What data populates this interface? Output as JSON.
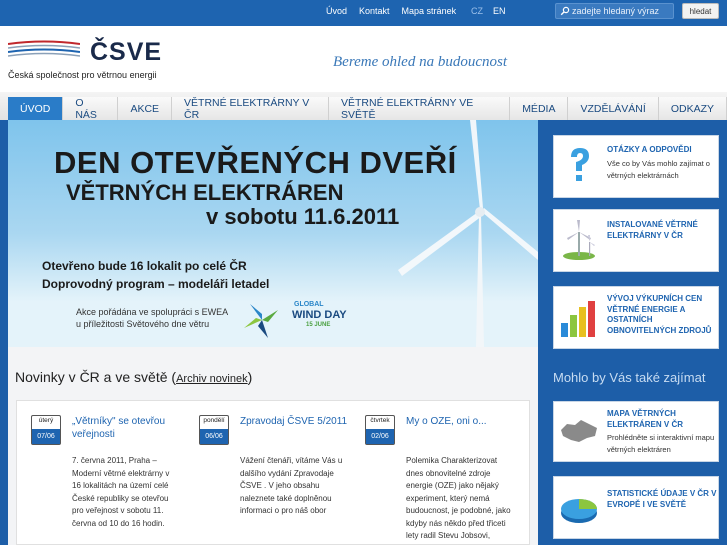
{
  "topbar": {
    "links": [
      "Úvod",
      "Kontakt",
      "Mapa stránek"
    ],
    "lang_cz": "CZ",
    "lang_en": "EN",
    "search_placeholder": "zadejte hledaný výraz",
    "search_button": "hledat"
  },
  "header": {
    "logo_title": "ČSVE",
    "logo_subtitle": "Česká společnost pro větrnou energii",
    "slogan": "Bereme ohled na budoucnost"
  },
  "nav": {
    "items": [
      "Úvod",
      "O nás",
      "Akce",
      "Větrné elektrárny v ČR",
      "Větrné elektrárny ve světě",
      "Média",
      "Vzdělávání",
      "Odkazy"
    ],
    "active_index": 0
  },
  "banner": {
    "line1": "DEN OTEVŘENÝCH DVEŘÍ",
    "line2": "VĚTRNÝCH ELEKTRÁREN",
    "line3": "v sobotu 11.6.2011",
    "line4": "Otevřeno bude 16 lokalit po celé ČR",
    "line5": "Doprovodný program – modeláři letadel",
    "line6": "Akce pořádána ve spolupráci s EWEA",
    "line7": "u příležitosti Světového dne větru",
    "wd_global": "GLOBAL",
    "wd_wind_day": "WIND DAY",
    "wd_date": "15 JUNE"
  },
  "news": {
    "title": "Novinky v ČR a ve světě",
    "archive_open": "(",
    "archive_link": "Archiv novinek",
    "archive_close": ")",
    "items": [
      {
        "day": "úterý",
        "date": "07/06",
        "headline": "„Větrníky\" se otevřou veřejnosti",
        "text": "7. června 2011, Praha – Moderní větrné elektrárny v 16 lokalitách na území celé České republiky se otevřou pro veřejnost v sobotu 11. června od 10 do 16 hodin."
      },
      {
        "day": "pondělí",
        "date": "06/06",
        "headline": "Zpravodaj ČSVE 5/2011",
        "text": "Vážení čtenáři, vítáme Vás u dalšího vydání Zpravodaje ČSVE . V jeho obsahu naleznete také doplněnou informaci o pro náš obor"
      },
      {
        "day": "čtvrtek",
        "date": "02/06",
        "headline": "My o OZE, oni o...",
        "text": "Polemika Charakterizovat dnes obnovitelné zdroje energie (OZE) jako nějaký experiment, který nemá budoucnost, je podobné, jako kdyby nás někdo před třiceti lety radil Stevu Jobsovi,"
      }
    ]
  },
  "sidebar": {
    "cards": [
      {
        "title": "Otázky a odpovědi",
        "desc": "Vše co by Vás mohlo zajímat o větrných elektrárnách",
        "icon": "question-icon"
      },
      {
        "title": "Instalované větrné elektrárny v ČR",
        "desc": "",
        "icon": "wind-turbine-icon"
      },
      {
        "title": "Vývoj výkupních cen větrné energie a ostatních obnovitelných zdrojů",
        "desc": "",
        "icon": "bar-chart-icon"
      }
    ],
    "also_title": "Mohlo by Vás také zajímat",
    "also_cards": [
      {
        "title": "Mapa větrných elektráren v ČR",
        "desc": "Prohlédněte si interaktivní mapu větrných elektráren",
        "icon": "map-icon"
      },
      {
        "title": "Statistické údaje v ČR v Evropě i ve světě",
        "desc": "",
        "icon": "pie-chart-icon"
      }
    ]
  },
  "colors": {
    "brand_blue": "#1e64b0",
    "nav_active": "#2a7cc8",
    "page_bg": "#1d5ea8"
  }
}
